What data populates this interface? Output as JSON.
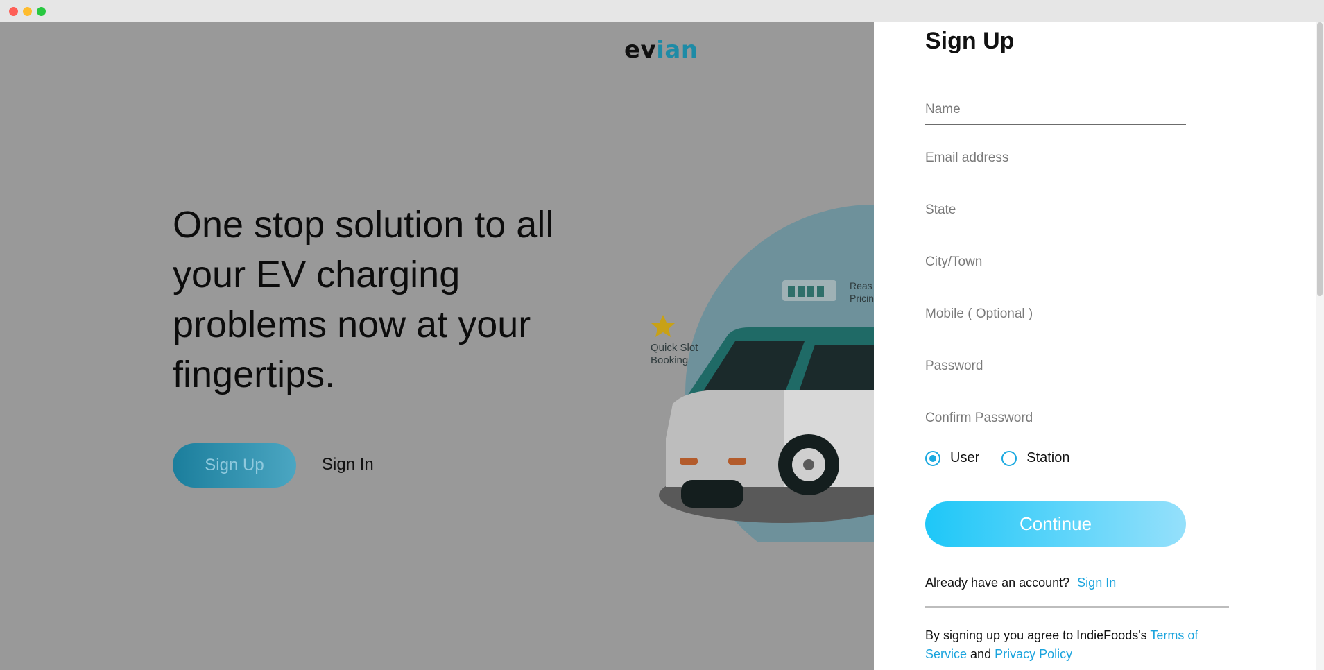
{
  "brand": {
    "ev": "ev",
    "ian": "ian"
  },
  "hero": {
    "headline": "One stop solution to all your EV charging problems now at your fingertips.",
    "signup_label": "Sign Up",
    "signin_label": "Sign In"
  },
  "illustration": {
    "quick_slot": "Quick Slot",
    "booking": "Booking",
    "reas_label": "Reas",
    "pricing_label": "Pricin"
  },
  "form": {
    "title": "Sign Up",
    "fields": {
      "name": "Name",
      "email": "Email address",
      "state": "State",
      "city": "City/Town",
      "mobile": "Mobile ( Optional )",
      "password": "Password",
      "confirm_password": "Confirm Password"
    },
    "role_user": "User",
    "role_station": "Station",
    "selected_role": "User",
    "continue_label": "Continue",
    "account_prompt": "Already have an account?",
    "account_link": "Sign In",
    "terms_prefix": "By signing up you agree to IndieFoods's",
    "terms_link": "Terms of Service",
    "terms_and": "and",
    "privacy_link": "Privacy Policy"
  },
  "colors": {
    "overlay": "#999999",
    "accent": "#1aa3dd",
    "continue_start": "#1ec7f8",
    "continue_end": "#95e0fb",
    "brand_teal": "#1e8ba6"
  }
}
